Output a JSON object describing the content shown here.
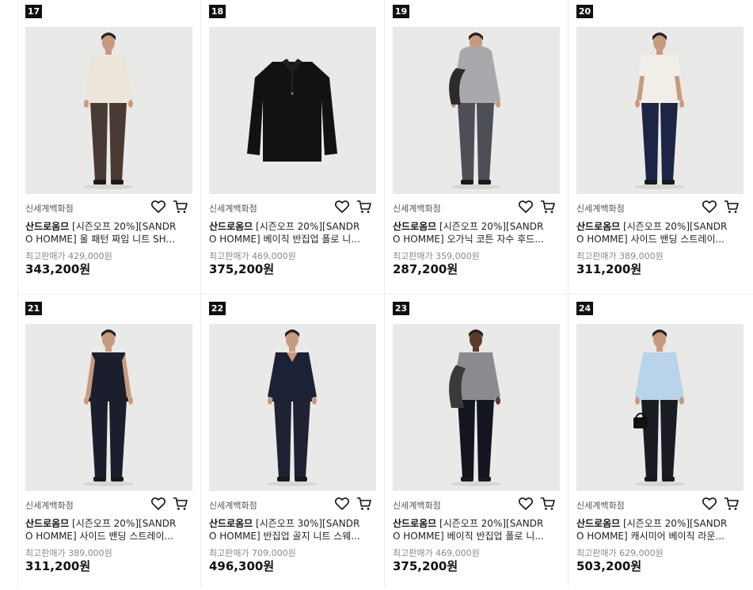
{
  "products": [
    {
      "rank": "17",
      "store": "신세계백화점",
      "brand": "산드로옴므",
      "name_line1": " [시즌오프 20%][SANDR",
      "name_line2": "O HOMME] 울 패턴 짜임 니트 SH...",
      "original_price": "최고판매가 429,000원",
      "price": "343,200원",
      "figure": "model-cream-knit"
    },
    {
      "rank": "18",
      "store": "신세계백화점",
      "brand": "산드로옴므",
      "name_line1": " [시즌오프 20%][SANDR",
      "name_line2": "O HOMME] 베이직 반집업 폴로 니...",
      "original_price": "최고판매가 469,000원",
      "price": "375,200원",
      "figure": "flat-black-polo"
    },
    {
      "rank": "19",
      "store": "신세계백화점",
      "brand": "산드로옴므",
      "name_line1": " [시즌오프 20%][SANDR",
      "name_line2": "O HOMME] 오가닉 코튼 자수 후드...",
      "original_price": "최고판매가 359,000원",
      "price": "287,200원",
      "figure": "model-grey-hoodie"
    },
    {
      "rank": "20",
      "store": "신세계백화점",
      "brand": "산드로옴므",
      "name_line1": " [시즌오프 20%][SANDR",
      "name_line2": "O HOMME] 사이드 밴딩 스트레이...",
      "original_price": "최고판매가 389,000원",
      "price": "311,200원",
      "figure": "model-white-shirt"
    },
    {
      "rank": "21",
      "store": "신세계백화점",
      "brand": "산드로옴므",
      "name_line1": " [시즌오프 20%][SANDR",
      "name_line2": "O HOMME] 사이드 밴딩 스트레이...",
      "original_price": "최고판매가 389,000원",
      "price": "311,200원",
      "figure": "model-navy-vest"
    },
    {
      "rank": "22",
      "store": "신세계백화점",
      "brand": "산드로옴므",
      "name_line1": " [시즌오프 30%][SANDR",
      "name_line2": "O HOMME] 반집업 골지 니트 스웨...",
      "original_price": "최고판매가 709,000원",
      "price": "496,300원",
      "figure": "model-navy-zip-knit"
    },
    {
      "rank": "23",
      "store": "신세계백화점",
      "brand": "산드로옴므",
      "name_line1": " [시즌오프 20%][SANDR",
      "name_line2": "O HOMME] 베이직 반집업 폴로 니...",
      "original_price": "최고판매가 469,000원",
      "price": "375,200원",
      "figure": "model-grey-polo"
    },
    {
      "rank": "24",
      "store": "신세계백화점",
      "brand": "산드로옴므",
      "name_line1": " [시즌오프 20%][SANDR",
      "name_line2": "O HOMME] 캐시미어 베이직 라운...",
      "original_price": "최고판매가 629,000원",
      "price": "503,200원",
      "figure": "model-lightblue-knit"
    }
  ],
  "icons": {
    "wishlist": "heart-icon",
    "cart": "cart-icon"
  },
  "colors": {
    "rank_badge": "#111111",
    "image_bg": "#e9e9e7",
    "divider": "#ececec"
  }
}
